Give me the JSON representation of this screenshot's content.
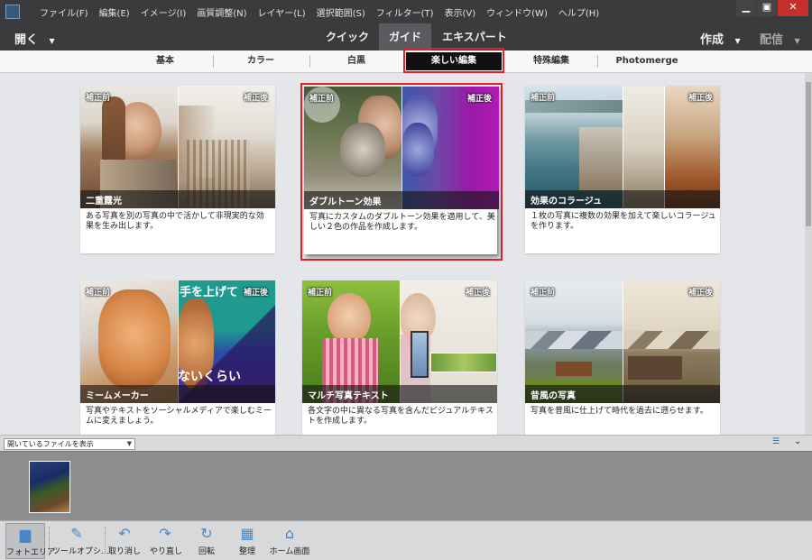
{
  "menu": {
    "items": [
      "ファイル(F)",
      "編集(E)",
      "イメージ(I)",
      "画質調整(N)",
      "レイヤー(L)",
      "選択範囲(S)",
      "フィルター(T)",
      "表示(V)",
      "ウィンドウ(W)",
      "ヘルプ(H)"
    ]
  },
  "window": {
    "minimize": "▁",
    "maximize": "▣",
    "close": "✕"
  },
  "modebar": {
    "open_label": "開く",
    "quick": "クイック",
    "guide": "ガイド",
    "expert": "エキスパート",
    "create": "作成",
    "share": "配信"
  },
  "categories": [
    "基本",
    "カラー",
    "白黒",
    "楽しい編集",
    "特殊編集",
    "Photomerge"
  ],
  "selected_category": "楽しい編集",
  "labels": {
    "before": "補正前",
    "after": "補正後"
  },
  "cards": [
    {
      "title": "二重露光",
      "desc": "ある写真を別の写真の中で活かして非現実的な効果を生み出します。"
    },
    {
      "title": "ダブルトーン効果",
      "desc": "写真にカスタムのダブルトーン効果を適用して、美しい２色の作品を作成します。"
    },
    {
      "title": "効果のコラージュ",
      "desc": "１枚の写真に複数の効果を加えて楽しいコラージュを作ります。"
    },
    {
      "title": "ミームメーカー",
      "desc": "写真やテキストをソーシャルメディアで楽しむミームに変えましょう。",
      "overlay_top": "手を上げて",
      "overlay_bottom": "ないくらい"
    },
    {
      "title": "マルチ写真テキスト",
      "desc": "各文字の中に異なる写真を含んだビジュアルテキストを作成します。"
    },
    {
      "title": "昔風の写真",
      "desc": "写真を昔風に仕上げて時代を過去に遡らせます。"
    }
  ],
  "bin": {
    "select_label": "開いているファイルを表示"
  },
  "toolbar": [
    "フォトエリア",
    "ツールオプシ...",
    "取り消し",
    "やり直し",
    "回転",
    "整理",
    "ホーム画面"
  ],
  "colors": {
    "accent_red": "#e2212a",
    "dark_bar": "#3a3b3d",
    "icon_blue": "#4a87c6"
  }
}
